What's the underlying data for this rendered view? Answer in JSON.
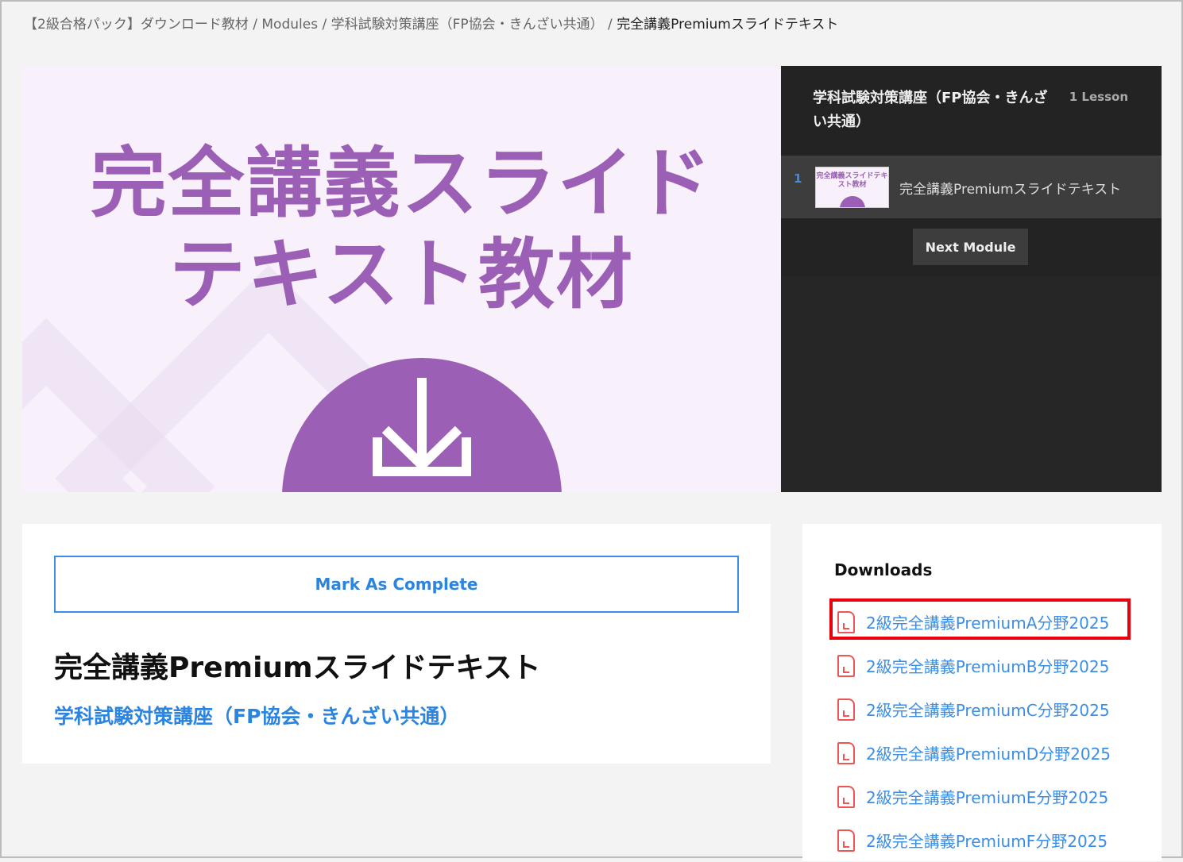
{
  "breadcrumb": {
    "items": [
      "【2級合格パック】ダウンロード教材",
      "Modules",
      "学科試験対策講座（FP協会・きんざい共通）"
    ],
    "current": "完全講義Premiumスライドテキスト"
  },
  "hero": {
    "line1": "完全講義スライド",
    "line2": "テキスト教材",
    "accent": "#9b5fb5"
  },
  "sidebar": {
    "module_title": "学科試験対策講座（FP協会・きんざい共通）",
    "lesson_count": "1 Lesson",
    "lessons": [
      {
        "number": "1",
        "thumb_text": "完全講義スライドテキスト教材",
        "title": "完全講義Premiumスライドテキスト"
      }
    ],
    "next_label": "Next Module"
  },
  "main": {
    "mark_complete": "Mark As Complete",
    "title": "完全講義Premiumスライドテキスト",
    "module_link": "学科試験対策講座（FP協会・きんざい共通）"
  },
  "downloads": {
    "heading": "Downloads",
    "items": [
      "2級完全講義PremiumA分野2025",
      "2級完全講義PremiumB分野2025",
      "2級完全講義PremiumC分野2025",
      "2級完全講義PremiumD分野2025",
      "2級完全講義PremiumE分野2025",
      "2級完全講義PremiumF分野2025"
    ],
    "highlight_color": "#e8000b"
  }
}
